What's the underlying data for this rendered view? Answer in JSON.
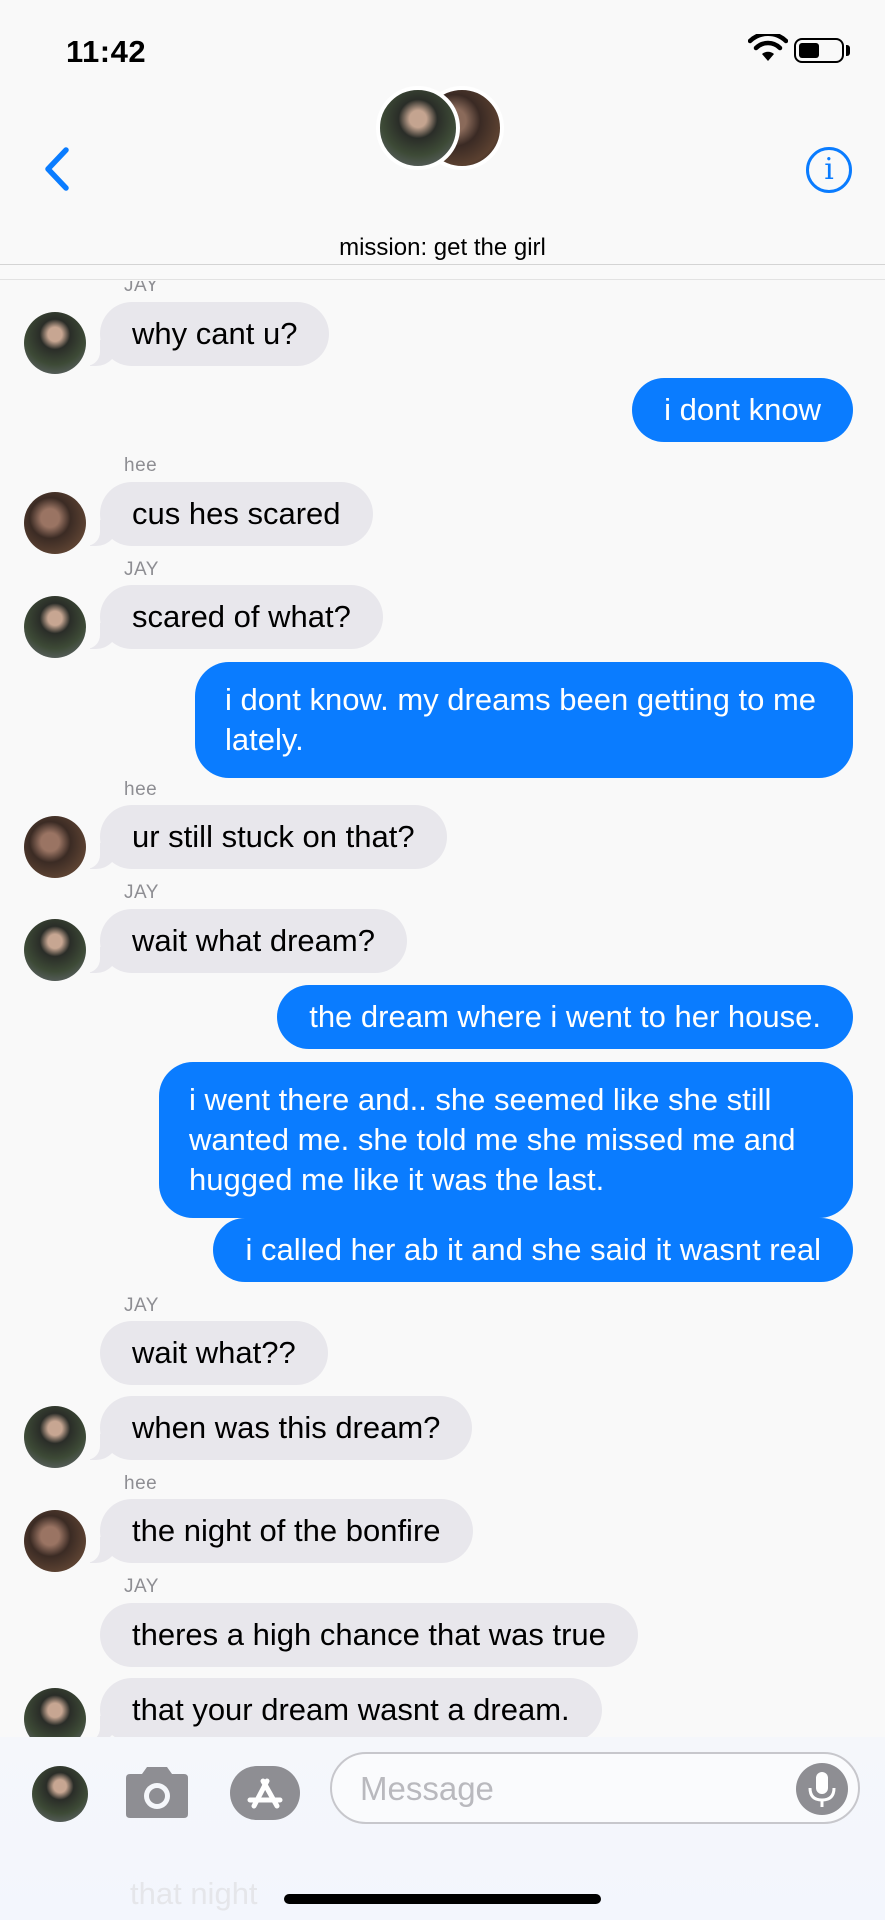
{
  "status_bar": {
    "time": "11:42"
  },
  "header": {
    "group_name": "mission: get the girl",
    "info_label": "i"
  },
  "messages": [
    {
      "sender": "JAY"
    },
    {
      "text": "why cant u?"
    },
    {
      "text": "i dont know"
    },
    {
      "sender": "hee"
    },
    {
      "text": "cus hes scared"
    },
    {
      "sender": "JAY"
    },
    {
      "text": "scared of what?"
    },
    {
      "text": "i dont know. my dreams been getting to me lately."
    },
    {
      "sender": "hee"
    },
    {
      "text": "ur still stuck on that?"
    },
    {
      "sender": "JAY"
    },
    {
      "text": "wait what dream?"
    },
    {
      "text": "the dream where i went to her house."
    },
    {
      "text": "i went there and.. she seemed like she still wanted me. she told me she missed me and hugged me like it was the last."
    },
    {
      "text": "i called her ab it and she said it wasnt real"
    },
    {
      "sender": "JAY"
    },
    {
      "text": "wait what??"
    },
    {
      "text": "when was this dream?"
    },
    {
      "sender": "hee"
    },
    {
      "text": "the night of the bonfire"
    },
    {
      "sender": "JAY"
    },
    {
      "text": "theres a high chance that was true"
    },
    {
      "text": "that your dream wasnt a dream."
    }
  ],
  "compose": {
    "placeholder": "Message",
    "ghost_text": "that night"
  },
  "colors": {
    "accent": "#0a7cff",
    "incoming_bubble": "#e8e7ec",
    "background": "#f9f9f9"
  },
  "icons": [
    "chevron-left-icon",
    "info-icon",
    "wifi-icon",
    "battery-icon",
    "camera-icon",
    "app-store-icon",
    "microphone-icon"
  ]
}
